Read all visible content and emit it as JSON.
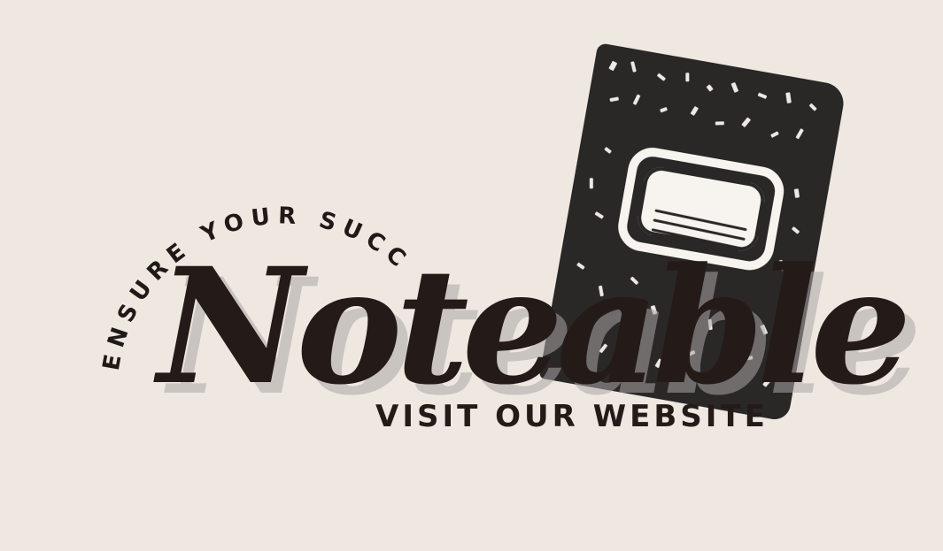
{
  "branding": {
    "tagline_arc": "ENSURE YOUR SUCCESS",
    "wordmark": "Noteable",
    "cta": "VISIT OUR WEBSITE"
  },
  "colors": {
    "background": "#EEE8E1",
    "ink": "#241B19",
    "notebook_cover": "#2A2727",
    "label": "#F7F4EF",
    "shadow": "#ABA6A6"
  },
  "icons": {
    "notebook": "composition-notebook-icon"
  }
}
